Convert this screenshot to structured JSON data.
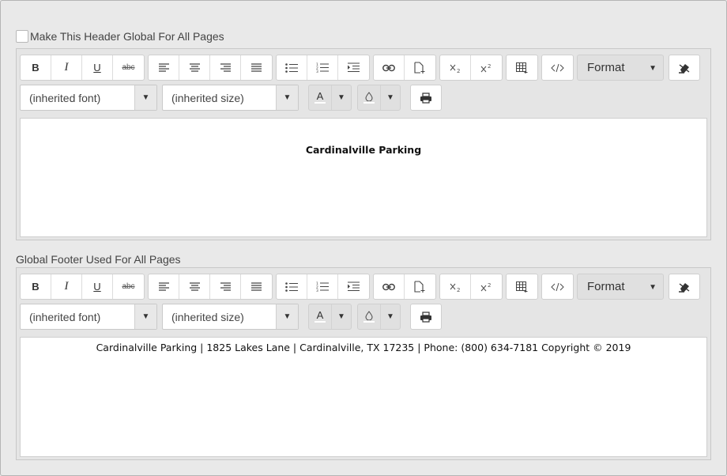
{
  "header_section": {
    "global_checkbox_label": "Make This Header Global For All Pages",
    "global_checked": false,
    "content_text": "Cardinalville Parking"
  },
  "footer_section": {
    "label": "Global Footer Used For All Pages",
    "content_text": "Cardinalville Parking | 1825 Lakes Lane | Cardinalville, TX 17235 | Phone: (800) 634-7181 Copyright © 2019"
  },
  "toolbar": {
    "bold": "B",
    "italic": "I",
    "underline": "U",
    "strikethrough": "abc",
    "format_label": "Format",
    "font_select": "(inherited font)",
    "size_select": "(inherited size)",
    "font_color_glyph": "A",
    "font_color": "#333333",
    "background_color": "#e0e0e0"
  },
  "icons": [
    "align-left-icon",
    "align-center-icon",
    "align-right-icon",
    "align-justify-icon",
    "unordered-list-icon",
    "ordered-list-icon",
    "indent-icon",
    "link-icon",
    "insert-file-icon",
    "subscript-icon",
    "superscript-icon",
    "table-icon",
    "code-view-icon",
    "eraser-icon",
    "print-icon",
    "chevron-down-icon",
    "droplet-icon"
  ]
}
